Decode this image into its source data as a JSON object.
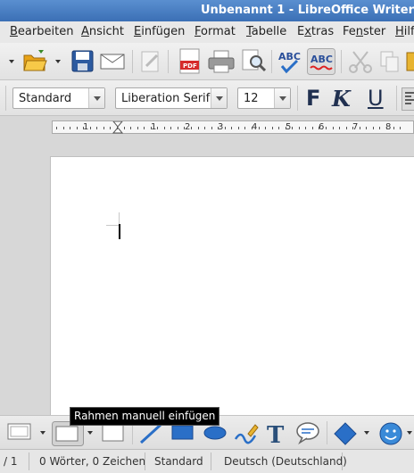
{
  "window": {
    "title": "Unbenannt 1 - LibreOffice Writer"
  },
  "menubar": {
    "items": [
      {
        "label": "Bearbeiten",
        "mnemonic": "B",
        "rest": "earbeiten"
      },
      {
        "label": "Ansicht",
        "mnemonic": "A",
        "rest": "nsicht"
      },
      {
        "label": "Einfügen",
        "mnemonic": "E",
        "rest": "infügen"
      },
      {
        "label": "Format",
        "mnemonic": "F",
        "rest": "ormat"
      },
      {
        "label": "Tabelle",
        "mnemonic": "T",
        "rest": "abelle"
      },
      {
        "label": "Extras",
        "mnemonic": "x",
        "pre": "E",
        "rest": "tras"
      },
      {
        "label": "Fenster",
        "mnemonic": "n",
        "pre": "Fe",
        "rest": "ster"
      },
      {
        "label": "Hilfe",
        "mnemonic": "H",
        "rest": "ilfe"
      }
    ]
  },
  "format_toolbar": {
    "paragraph_style": "Standard",
    "font_name": "Liberation Serif",
    "font_size": "12",
    "bold_label": "F",
    "italic_label": "K",
    "underline_label": "U"
  },
  "ruler": {
    "labels": [
      "1",
      "1",
      "1",
      "2",
      "3",
      "4",
      "5",
      "6",
      "7",
      "8"
    ]
  },
  "tooltip": {
    "text": "Rahmen manuell einfügen"
  },
  "statusbar": {
    "page": "/ 1",
    "words": "0 Wörter, 0 Zeichen",
    "page_style": "Standard",
    "language": "Deutsch (Deutschland)"
  },
  "colors": {
    "titlebar": "#3b6fb5",
    "accent": "#2a5fa8"
  }
}
